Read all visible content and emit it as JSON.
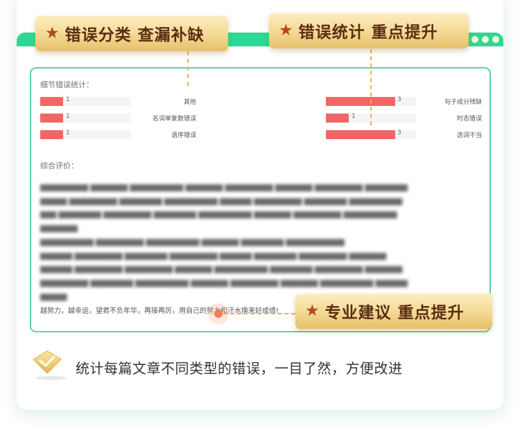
{
  "badges": {
    "classify": "错误分类 查漏补缺",
    "stats": "错误统计 重点提升",
    "advice": "专业建议 重点提升",
    "star": "★"
  },
  "panel": {
    "detail_title": "细节错误统计：",
    "rows_left": [
      {
        "label": "其他",
        "count": "1",
        "value": 1
      },
      {
        "label": "名词单复数错误",
        "count": "1",
        "value": 1
      },
      {
        "label": "语序错误",
        "count": "1",
        "value": 1
      }
    ],
    "rows_right": [
      {
        "label": "句子成分残缺",
        "count": "3",
        "value": 3
      },
      {
        "label": "时态错误",
        "count": "1",
        "value": 1
      },
      {
        "label": "选词不当",
        "count": "3",
        "value": 3
      }
    ],
    "max_value": 3,
    "overall_title": "综合评价：",
    "closing_line": "越努力，越幸运，望君不负年华，再接再厉，用自己的努力和汗水换来好成绩!"
  },
  "caption": "统计每篇文章不同类型的错误，一目了然，方便改进",
  "colors": {
    "green": "#2fd793",
    "panel_border": "#5ad4a0",
    "bar_red": "#f36666",
    "badge_gold": "#f3d893",
    "badge_text": "#5a2d12",
    "star": "#b34a1e",
    "connector": "#e9b25a"
  },
  "icons": [
    "star-icon",
    "diamond-check-icon"
  ]
}
